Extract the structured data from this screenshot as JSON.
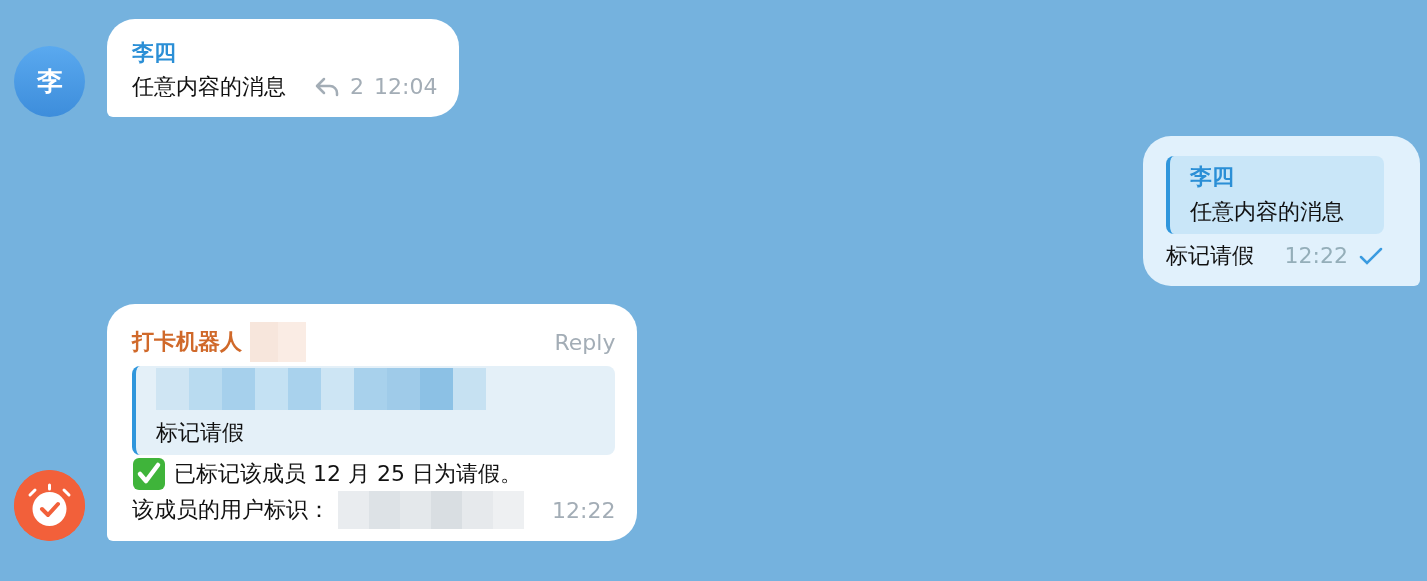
{
  "messages": [
    {
      "kind": "incoming",
      "avatar": {
        "kind": "letter",
        "text": "李"
      },
      "sender": "李四",
      "color": "#2b8fd6",
      "text": "任意内容的消息",
      "replies": "2",
      "time": "12:04"
    },
    {
      "kind": "outgoing",
      "quote": {
        "sender": "李四",
        "text": "任意内容的消息"
      },
      "text": "标记请假",
      "time": "12:22",
      "sent": true
    },
    {
      "kind": "incoming",
      "avatar": {
        "kind": "bot"
      },
      "sender": "打卡机器人",
      "color": "#d0692a",
      "sender_redacted": true,
      "reply_action": "Reply",
      "quote": {
        "sender_redacted": true,
        "text": "标记请假"
      },
      "lines": [
        {
          "kind": "success",
          "text": "已标记该成员 12 月 25 日为请假。"
        },
        {
          "kind": "plain",
          "text": "该成员的用户标识：",
          "redacted": true
        }
      ],
      "time": "12:22"
    }
  ]
}
